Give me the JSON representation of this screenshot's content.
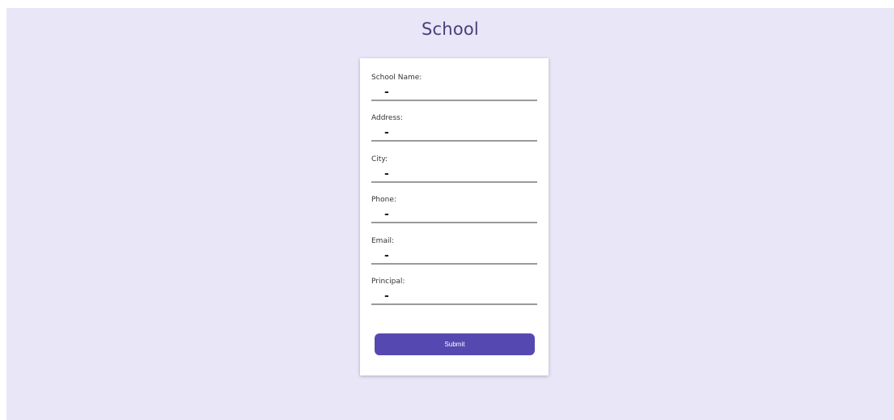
{
  "page": {
    "title": "School",
    "background_color": "#e8e6f7",
    "accent_color": "#5549b1"
  },
  "form": {
    "fields": [
      {
        "label": "School Name:",
        "value": "-"
      },
      {
        "label": "Address:",
        "value": "-"
      },
      {
        "label": "City:",
        "value": "-"
      },
      {
        "label": "Phone:",
        "value": "-"
      },
      {
        "label": "Email:",
        "value": "-"
      },
      {
        "label": "Principal:",
        "value": "-"
      }
    ],
    "submit_label": "Submit"
  }
}
